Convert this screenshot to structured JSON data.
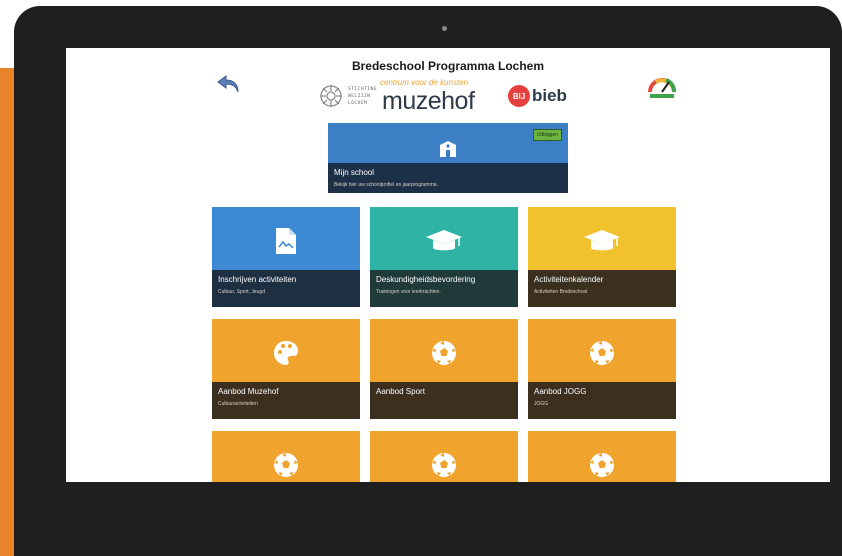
{
  "page": {
    "title": "Bredeschool Programma Lochem"
  },
  "logos": {
    "stichting_lines": [
      "STICHTING",
      "WELZIJN",
      "LOCHEM"
    ],
    "muzehof_tagline": "centrum voor de kunsten",
    "muzehof_word": "muzehof",
    "bieb_badge": "BIJ",
    "bieb_word": "bieb"
  },
  "school_tile": {
    "title": "Mijn school",
    "subtitle": "Bekijk hier uw schoolprofiel en jaarprogramma.",
    "badge": "Uitloggen",
    "icon": "school-icon"
  },
  "tiles": [
    {
      "title": "Inschrijven activiteiten",
      "subtitle": "Cultuur, Sport, Jeugd",
      "icon": "document-icon",
      "color": "#3b8ad3"
    },
    {
      "title": "Deskundigheidsbevordering",
      "subtitle": "Trainingen voor leerkrachten.",
      "icon": "graduation-cap-icon",
      "color": "#2fb3a4"
    },
    {
      "title": "Activiteitenkalender",
      "subtitle": "Activiteiten Bredeschool",
      "icon": "graduation-cap-icon",
      "color": "#f2c12e"
    },
    {
      "title": "Aanbod Muzehof",
      "subtitle": "Cultuuractiviteiten",
      "icon": "palette-icon",
      "color": "#f0a42e"
    },
    {
      "title": "Aanbod Sport",
      "subtitle": "",
      "icon": "soccer-ball-icon",
      "color": "#f0a42e"
    },
    {
      "title": "Aanbod JOGG",
      "subtitle": "JOGG",
      "icon": "soccer-ball-icon",
      "color": "#f0a42e"
    },
    {
      "title": "",
      "subtitle": "",
      "icon": "soccer-ball-icon",
      "color": "#f0a42e"
    },
    {
      "title": "",
      "subtitle": "",
      "icon": "soccer-ball-icon",
      "color": "#f0a42e"
    },
    {
      "title": "",
      "subtitle": "",
      "icon": "soccer-ball-icon",
      "color": "#f0a42e"
    }
  ],
  "colors": {
    "frame": "#1f1f1f",
    "accent_orange": "#e8832a"
  }
}
